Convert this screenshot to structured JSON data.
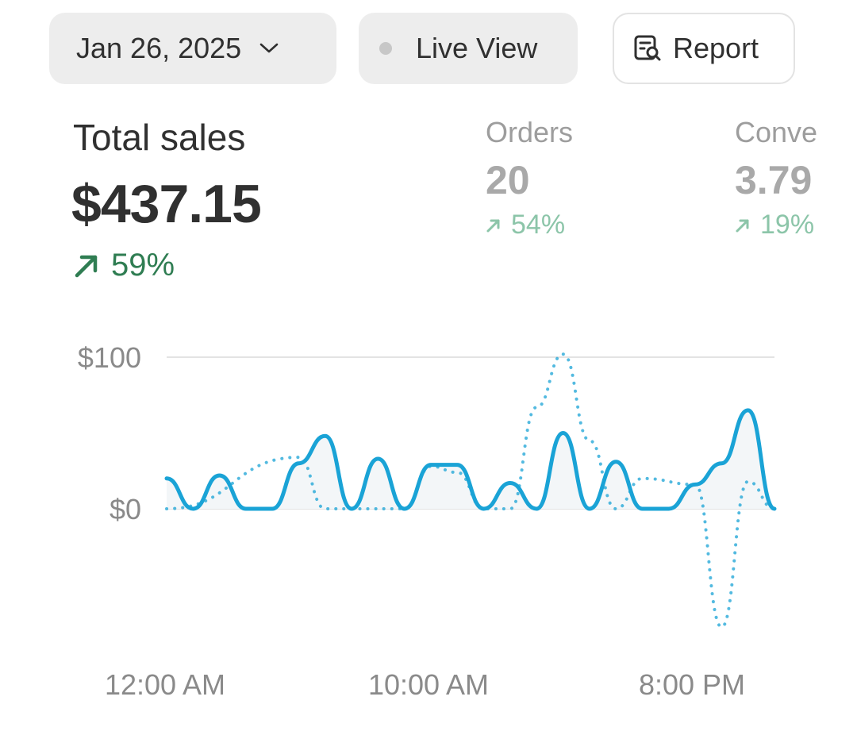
{
  "toolbar": {
    "date_label": "Jan 26, 2025",
    "live_label": "Live View",
    "report_label": "Report"
  },
  "metrics": {
    "total_sales": {
      "label": "Total sales",
      "value": "$437.15",
      "delta": "59%"
    },
    "orders": {
      "label": "Orders",
      "value": "20",
      "delta": "54%"
    },
    "conversion": {
      "label": "Conve",
      "value": "3.79",
      "delta": "19%"
    }
  },
  "colors": {
    "line": "#1aa3d6",
    "positive": "#2f7d52",
    "positive_muted": "#8cc5a9",
    "grid": "#e3e3e3"
  },
  "chart_data": {
    "type": "line",
    "y_tick_labels": [
      "$100",
      "$0"
    ],
    "x_tick_labels": [
      "12:00 AM",
      "10:00 AM",
      "8:00 PM"
    ],
    "ylim": [
      -80,
      100
    ],
    "grid": true,
    "series": [
      {
        "style": "solid",
        "points": [
          [
            0,
            20
          ],
          [
            1,
            0
          ],
          [
            2,
            22
          ],
          [
            3,
            0
          ],
          [
            4,
            0
          ],
          [
            5,
            30
          ],
          [
            6,
            48
          ],
          [
            7,
            0
          ],
          [
            8,
            33
          ],
          [
            9,
            0
          ],
          [
            10,
            29
          ],
          [
            11,
            29
          ],
          [
            12,
            0
          ],
          [
            13,
            17
          ],
          [
            14,
            0
          ],
          [
            15,
            50
          ],
          [
            16,
            0
          ],
          [
            17,
            31
          ],
          [
            18,
            0
          ],
          [
            19,
            0
          ],
          [
            20,
            16
          ],
          [
            21,
            30
          ],
          [
            22,
            65
          ],
          [
            23,
            0
          ]
        ]
      },
      {
        "style": "dotted",
        "points": [
          [
            0,
            0
          ],
          [
            5,
            34
          ],
          [
            6,
            0
          ],
          [
            9,
            0
          ],
          [
            10,
            28
          ],
          [
            11,
            24
          ],
          [
            12,
            0
          ],
          [
            13,
            0
          ],
          [
            14,
            67
          ],
          [
            15,
            102
          ],
          [
            16,
            45
          ],
          [
            17,
            0
          ],
          [
            18,
            20
          ],
          [
            20,
            16
          ],
          [
            21,
            -78
          ],
          [
            22,
            18
          ],
          [
            23,
            0
          ]
        ]
      }
    ]
  }
}
